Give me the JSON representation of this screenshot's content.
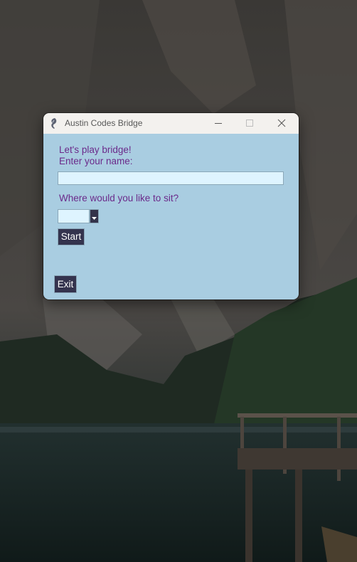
{
  "window": {
    "title": "Austin Codes Bridge",
    "icon": "feather-app-icon",
    "controls": [
      "minimize-icon",
      "maximize-icon",
      "close-icon"
    ]
  },
  "form": {
    "greeting": "Let's play bridge!",
    "name_label": "Enter your name:",
    "name_value": "",
    "seat_label": "Where would you like to sit?",
    "seat_value": "",
    "start_label": "Start",
    "exit_label": "Exit"
  },
  "colors": {
    "client_bg": "#a9cde1",
    "label_text": "#6b2a8a",
    "button_bg": "#34334e",
    "input_bg": "#def4ff",
    "titlebar_bg": "#f3f1ee"
  }
}
